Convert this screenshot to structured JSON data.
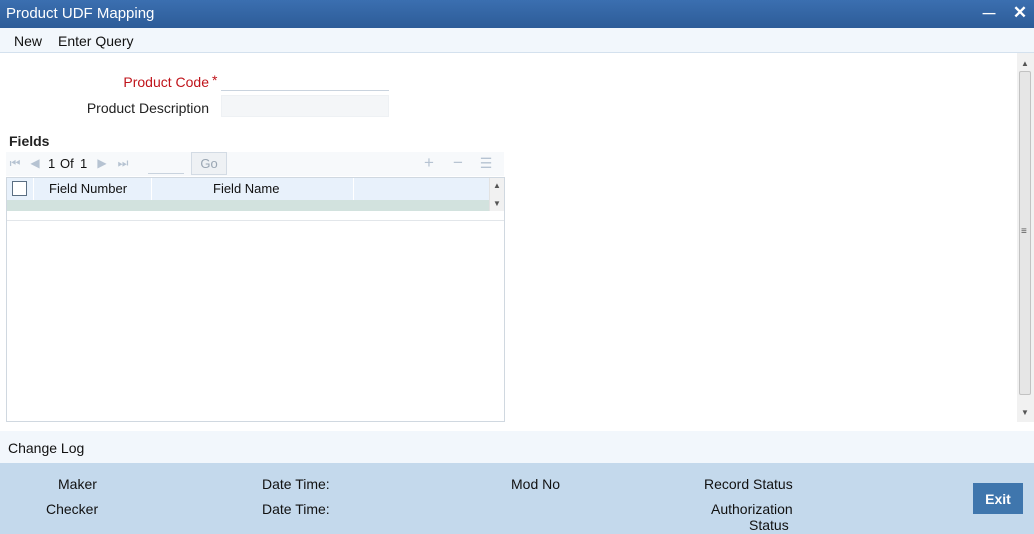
{
  "window": {
    "title": "Product UDF Mapping",
    "minimize_icon": "minimize-icon",
    "close_icon": "close-icon"
  },
  "menu": {
    "items": [
      {
        "label": "New"
      },
      {
        "label": "Enter Query"
      }
    ]
  },
  "form": {
    "product_code_label": "Product Code",
    "required_marker": "*",
    "product_code_value": "",
    "product_description_label": "Product Description",
    "product_description_value": ""
  },
  "fields_section": {
    "title": "Fields",
    "pagination": {
      "current": "1",
      "of_label": "Of",
      "total": "1",
      "page_input": "",
      "go_label": "Go"
    },
    "columns": [
      "Field Number",
      "Field Name"
    ],
    "rows": []
  },
  "change_log": {
    "label": "Change Log"
  },
  "footer": {
    "maker_label": "Maker",
    "checker_label": "Checker",
    "maker_datetime_label": "Date Time:",
    "checker_datetime_label": "Date Time:",
    "mod_no_label": "Mod No",
    "record_status_label": "Record Status",
    "authorization_status_line1": "Authorization",
    "authorization_status_line2": "Status",
    "exit_label": "Exit"
  },
  "colors": {
    "titlebar": "#2d5c98",
    "required_label": "#c0141b",
    "footer_bg": "#c4d9ec",
    "exit_button": "#3f76ad"
  }
}
